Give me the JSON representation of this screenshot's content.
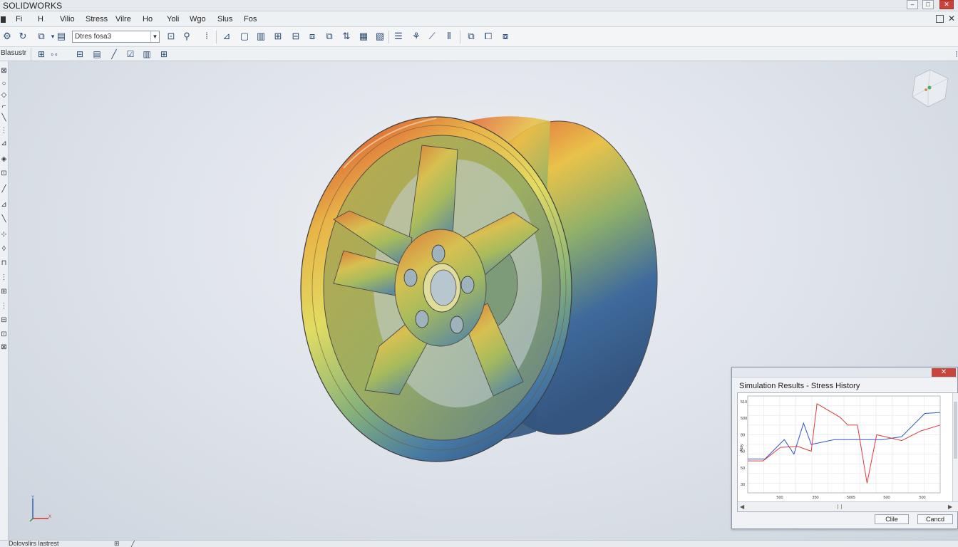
{
  "app": {
    "title": "SOLIDWORKS"
  },
  "window_controls": {
    "minimize": "–",
    "restore": "□",
    "close": "✕"
  },
  "menu": {
    "items": [
      "Fi",
      "H",
      "Vilio",
      "Stress",
      "Vilre",
      "Ho",
      "Yoli",
      "Wgo",
      "Slus",
      "Fos"
    ],
    "right_close": "✕"
  },
  "toolbar": {
    "study_combo_value": "Dtres fosa3"
  },
  "toolbar2": {
    "label": "Blasustr"
  },
  "status": {
    "text": "Dolovslirs lastrest"
  },
  "sim_window": {
    "close": "✕",
    "title": "Simulation Results - Stress History",
    "ok_button": "Clile",
    "cancel_button": "Cancd"
  },
  "chart_data": {
    "type": "line",
    "title": "Simulation Results - Stress History",
    "x_tick_labels": [
      "500",
      "350",
      "5005",
      "500",
      "500"
    ],
    "y_tick_labels": [
      "510",
      "500",
      "80",
      "60",
      "50",
      "30"
    ],
    "ylabel": "Ably",
    "xlim": [
      0,
      100
    ],
    "ylim": [
      0,
      100
    ],
    "grid": true,
    "series": [
      {
        "color": "#2f54c8",
        "x": [
          0,
          9,
          19,
          24,
          29,
          33,
          45,
          55,
          70,
          80,
          92,
          100
        ],
        "y": [
          35,
          35,
          55,
          40,
          72,
          50,
          55,
          55,
          55,
          58,
          82,
          83
        ]
      },
      {
        "color": "#e03a3a",
        "x": [
          0,
          8,
          17,
          26,
          33,
          36,
          48,
          52,
          57,
          62,
          67,
          80,
          90,
          100
        ],
        "y": [
          33,
          33,
          47,
          48,
          43,
          92,
          78,
          70,
          70,
          10,
          60,
          54,
          64,
          70
        ]
      }
    ]
  },
  "colors": {
    "stress_high": "#dc4a2f",
    "stress_mid": "#e8d44c",
    "stress_low": "#3f6a9c",
    "sim_close": "#c9453b"
  }
}
